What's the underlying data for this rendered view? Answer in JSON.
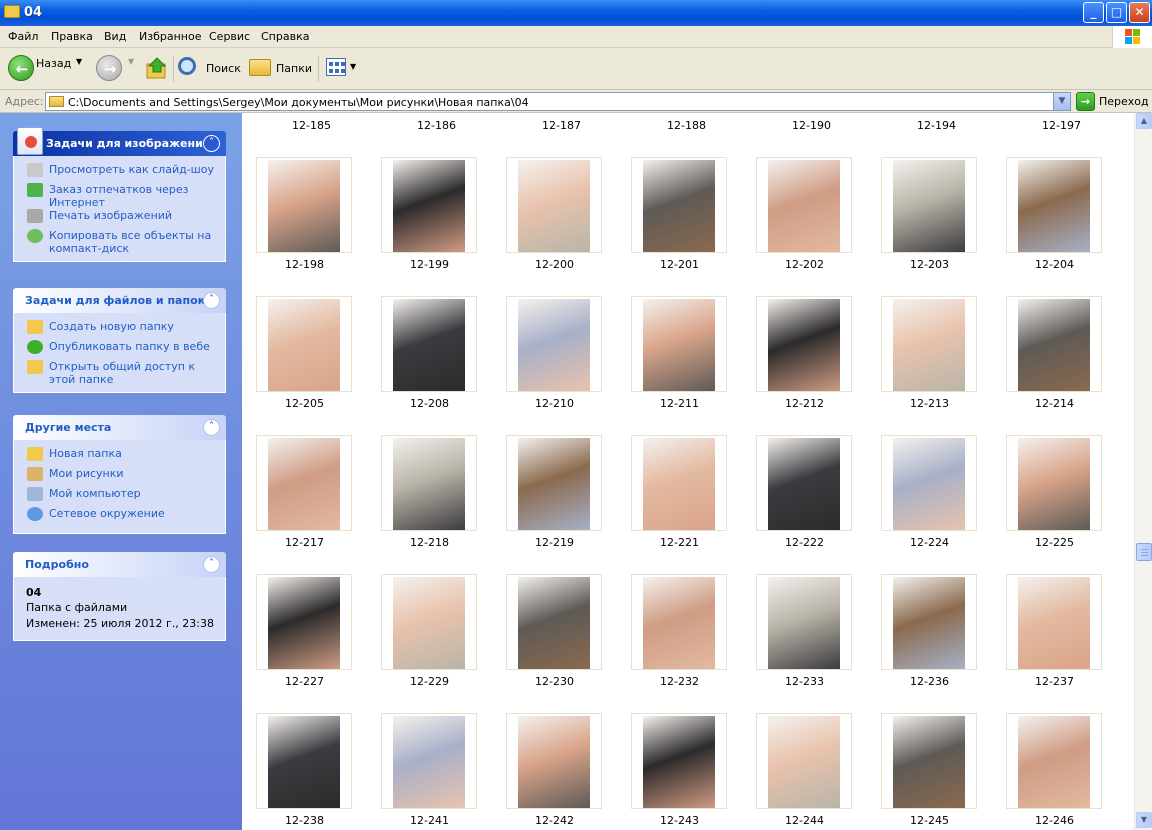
{
  "window": {
    "title": "04",
    "minimize": "_",
    "maximize": "□",
    "close": "✕"
  },
  "menu": [
    "Файл",
    "Правка",
    "Вид",
    "Избранное",
    "Сервис",
    "Справка"
  ],
  "toolbar": {
    "back": "Назад",
    "search": "Поиск",
    "folders": "Папки"
  },
  "address": {
    "label": "Адрес:",
    "value": "C:\\Documents and Settings\\Sergey\\Мои документы\\Мои рисунки\\Новая папка\\04",
    "go": "Переход"
  },
  "sidebar": {
    "image_tasks": {
      "title": "Задачи для изображений",
      "items": [
        "Просмотреть как слайд-шоу",
        "Заказ отпечатков через Интернет",
        "Печать изображений",
        "Копировать все объекты на компакт-диск"
      ]
    },
    "file_tasks": {
      "title": "Задачи для файлов и папок",
      "items": [
        "Создать новую папку",
        "Опубликовать папку в вебе",
        "Открыть общий доступ к этой папке"
      ]
    },
    "other_places": {
      "title": "Другие места",
      "items": [
        "Новая папка",
        "Мои рисунки",
        "Мой компьютер",
        "Сетевое окружение"
      ]
    },
    "details": {
      "title": "Подробно",
      "name": "04",
      "type": "Папка с файлами",
      "modified": "Изменен: 25 июля 2012 г., 23:38"
    }
  },
  "files": {
    "top_row": [
      "12-185",
      "12-186",
      "12-187",
      "12-188",
      "12-190",
      "12-194",
      "12-197"
    ],
    "rows": [
      [
        "12-198",
        "12-199",
        "12-200",
        "12-201",
        "12-202",
        "12-203",
        "12-204"
      ],
      [
        "12-205",
        "12-208",
        "12-210",
        "12-211",
        "12-212",
        "12-213",
        "12-214"
      ],
      [
        "12-217",
        "12-218",
        "12-219",
        "12-221",
        "12-222",
        "12-224",
        "12-225"
      ],
      [
        "12-227",
        "12-229",
        "12-230",
        "12-232",
        "12-233",
        "12-236",
        "12-237"
      ],
      [
        "12-238",
        "12-241",
        "12-242",
        "12-243",
        "12-244",
        "12-245",
        "12-246"
      ]
    ]
  },
  "colors": {
    "title_bar": "#0a5fe0",
    "sidebar": "#6f8be0",
    "link": "#215dc6",
    "toolbar": "#ece9d8"
  }
}
